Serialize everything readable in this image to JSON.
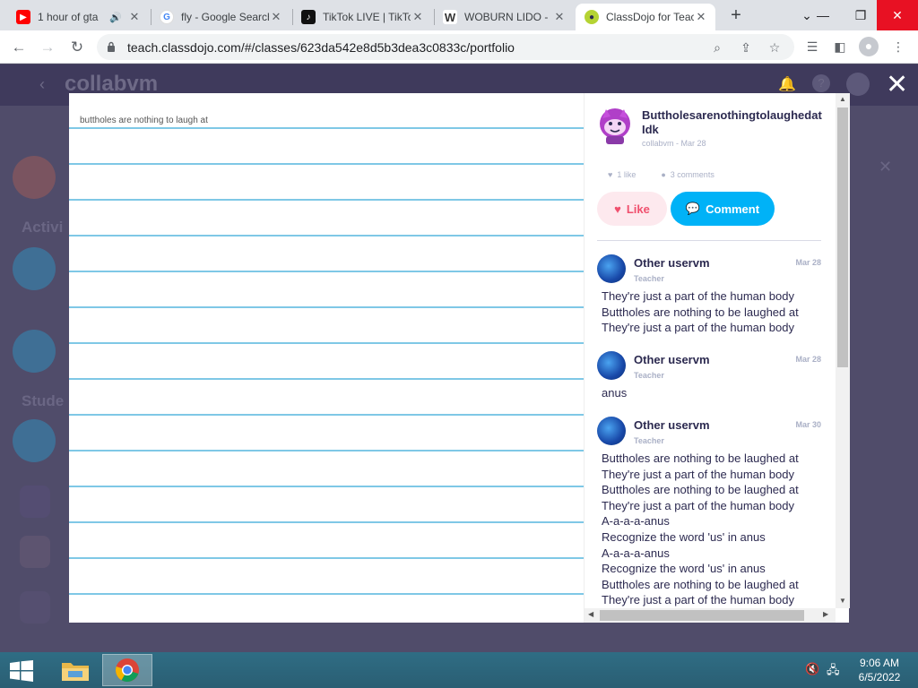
{
  "browser": {
    "tabs": [
      {
        "title": "1 hour of gta",
        "favicon": "youtube-icon",
        "audio": true
      },
      {
        "title": "fly - Google Search",
        "favicon": "google-icon"
      },
      {
        "title": "TikTok LIVE | TikTok",
        "favicon": "tiktok-icon"
      },
      {
        "title": "WOBURN LIDO -",
        "favicon": "wix-icon"
      },
      {
        "title": "ClassDojo for Teachers",
        "favicon": "classdojo-icon",
        "active": true
      }
    ],
    "url": "teach.classdojo.com/#/classes/623da542e8d5b3dea3c0833c/portfolio"
  },
  "background": {
    "logo": "collabvm",
    "subtitle": "",
    "activity_label": "Activi",
    "students_label": "Stude"
  },
  "post": {
    "note_text": "buttholes are nothing to laugh at",
    "author": {
      "name_line1": "Buttholesarenothingtolaughedat",
      "name_line2": "Idk",
      "meta": "collabvm - Mar 28"
    },
    "likes": "1 like",
    "comments_count": "3 comments",
    "like_label": "Like",
    "comment_label": "Comment"
  },
  "comments": [
    {
      "name": "Other uservm",
      "role": "Teacher",
      "date": "Mar 28",
      "lines": [
        "They're just a part of the human body",
        "Buttholes are nothing to be laughed at",
        "They're just a part of the human body"
      ]
    },
    {
      "name": "Other uservm",
      "role": "Teacher",
      "date": "Mar 28",
      "lines": [
        "anus"
      ]
    },
    {
      "name": "Other uservm",
      "role": "Teacher",
      "date": "Mar 30",
      "lines": [
        "Buttholes are nothing to be laughed at",
        "They're just a part of the human body",
        "Buttholes are nothing to be laughed at",
        "They're just a part of the human body",
        "A-a-a-a-anus",
        "Recognize the word 'us' in anus",
        "A-a-a-a-anus",
        "Recognize the word 'us' in anus",
        "Buttholes are nothing to be laughed at",
        "They're just a part of the human body"
      ]
    }
  ],
  "taskbar": {
    "time": "9:06 AM",
    "date": "6/5/2022"
  },
  "colors": {
    "accent": "#00b2f7",
    "like": "#f0506e",
    "ruled_line": "#7fc8e6",
    "overlay": "#504c6a"
  }
}
